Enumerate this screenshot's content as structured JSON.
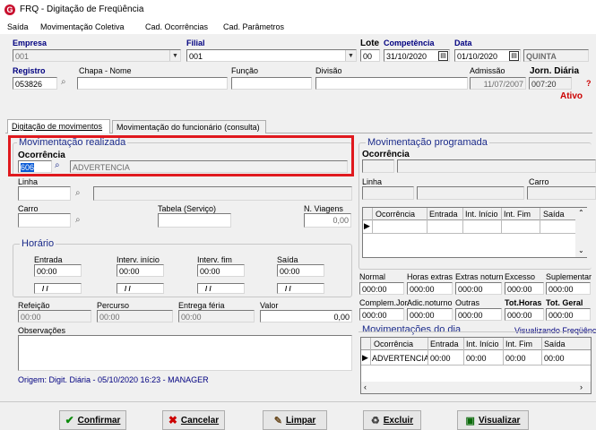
{
  "window": {
    "title": "FRQ - Digitação de Freqüência"
  },
  "menu": [
    "Saída",
    "Movimentação Coletiva",
    "Cad. Ocorrências",
    "Cad. Parâmetros"
  ],
  "header": {
    "empresa_label": "Empresa",
    "empresa_value": "001",
    "filial_label": "Filial",
    "filial_value": "001",
    "lote_label": "Lote",
    "lote_value": "00",
    "competencia_label": "Competência",
    "competencia_value": "31/10/2020",
    "data_label": "Data",
    "data_value": "01/10/2020",
    "weekday": "QUINTA",
    "registro_label": "Registro",
    "registro_value": "053826",
    "chapa_label": "Chapa - Nome",
    "funcao_label": "Função",
    "divisao_label": "Divisão",
    "admissao_label": "Admissão",
    "admissao_value": "11/07/2007",
    "jornada_label": "Jorn. Diária",
    "jornada_value": "007:20",
    "help": "?",
    "status": "Ativo"
  },
  "tabs": [
    "Digitação de movimentos",
    "Movimentação do funcionário (consulta)"
  ],
  "left": {
    "realizada_title": "Movimentação realizada",
    "ocorrencia_label": "Ocorrência",
    "ocorrencia_code": "606",
    "ocorrencia_desc": "ADVERTENCIA",
    "linha_label": "Linha",
    "carro_label": "Carro",
    "tabela_label": "Tabela (Serviço)",
    "nviagens_label": "N. Viagens",
    "nviagens_value": "0,00",
    "horario_title": "Horário",
    "entrada_label": "Entrada",
    "entrada_value": "00:00",
    "entrada_date": "/ /",
    "ii_label": "Interv. início",
    "ii_value": "00:00",
    "ii_date": "/ /",
    "if_label": "Interv. fim",
    "if_value": "00:00",
    "if_date": "/ /",
    "saida_label": "Saída",
    "saida_value": "00:00",
    "saida_date": "/ /",
    "refeicao_label": "Refeição",
    "refeicao_value": "00:00",
    "percurso_label": "Percurso",
    "percurso_value": "00:00",
    "entrega_label": "Entrega féria",
    "entrega_value": "00:00",
    "valor_label": "Valor",
    "valor_value": "0,00",
    "obs_label": "Observações",
    "origem": "Origem: Digit. Diária - 05/10/2020 16:23 - MANAGER"
  },
  "right": {
    "programada_title": "Movimentação programada",
    "ocorrencia_label": "Ocorrência",
    "linha_label": "Linha",
    "carro_label": "Carro",
    "grid_cols": [
      "Ocorrência",
      "Entrada",
      "Int. Início",
      "Int. Fim",
      "Saída"
    ],
    "totals_row1_labels": [
      "Normal",
      "Horas extras",
      "Extras noturn",
      "Excesso",
      "Suplementar"
    ],
    "totals_row1_values": [
      "000:00",
      "000:00",
      "000:00",
      "000:00",
      "000:00"
    ],
    "totals_row2_labels": [
      "Complem.Jor.",
      "Adic.noturno",
      "Outras",
      "Tot.Horas",
      "Tot. Geral"
    ],
    "totals_row2_values": [
      "000:00",
      "000:00",
      "000:00",
      "000:00",
      "000:00"
    ],
    "dia_title": "Movimentações do dia",
    "visualizando": "Visualizando Freqüência",
    "dia_cols": [
      "Ocorrência",
      "Entrada",
      "Int. Início",
      "Int. Fim",
      "Saída"
    ],
    "dia_row": [
      "ADVERTENCIA",
      "00:00",
      "00:00",
      "00:00",
      "00:00"
    ]
  },
  "buttons": {
    "confirmar": "Confirmar",
    "cancelar": "Cancelar",
    "limpar": "Limpar",
    "excluir": "Excluir",
    "visualizar": "Visualizar"
  },
  "colors": {
    "highlight": "#e0191e",
    "brand": "#c8102e",
    "blue_title": "#1a2a8a",
    "status": "#cc0000"
  }
}
